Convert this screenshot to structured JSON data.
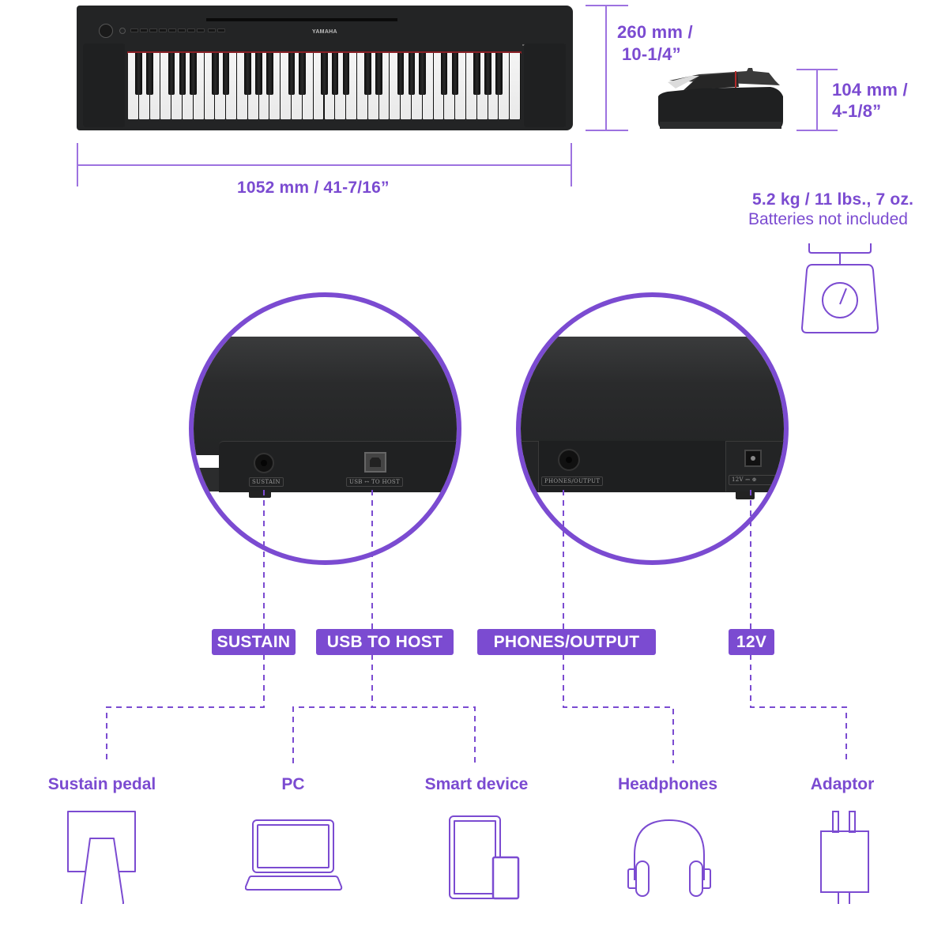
{
  "brand": {
    "logo_text": "YAMAHA"
  },
  "colors": {
    "accent": "#7B4BD1",
    "instrument_body": "#232425",
    "pill_text": "#FFFFFF"
  },
  "dimensions": {
    "width": "1052 mm / 41-7/16”",
    "depth_line1": "260 mm /",
    "depth_line2": "10-1/4”",
    "height_line1": "104 mm /",
    "height_line2": "4-1/8”",
    "weight": "5.2 kg / 11 lbs., 7 oz.",
    "weight_note": "Batteries not included"
  },
  "keyboard": {
    "keys_total": 61,
    "white_keys": 36
  },
  "ports": [
    {
      "id": "sustain",
      "label": "SUSTAIN",
      "panel_label": "SUSTAIN"
    },
    {
      "id": "usb",
      "label": "USB TO HOST",
      "panel_label": "USB ↔ TO HOST"
    },
    {
      "id": "phones",
      "label": "PHONES/OUTPUT",
      "panel_label": "PHONES/OUTPUT"
    },
    {
      "id": "dc",
      "label": "12V",
      "panel_label": "12V ⎓ ⊕"
    }
  ],
  "devices": [
    {
      "id": "sustain-pedal",
      "label": "Sustain pedal",
      "icon": "sustain-pedal-icon"
    },
    {
      "id": "pc",
      "label": "PC",
      "icon": "laptop-icon"
    },
    {
      "id": "smart-device",
      "label": "Smart device",
      "icon": "tablet-phone-icon"
    },
    {
      "id": "headphones",
      "label": "Headphones",
      "icon": "headphones-icon"
    },
    {
      "id": "adaptor",
      "label": "Adaptor",
      "icon": "power-adaptor-icon"
    }
  ]
}
